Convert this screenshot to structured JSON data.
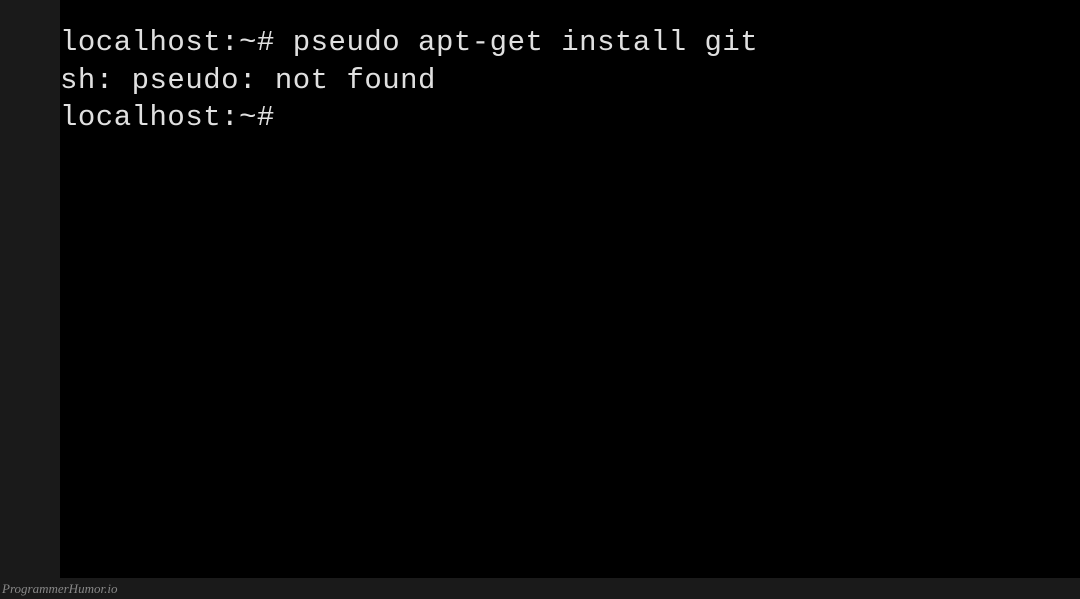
{
  "terminal": {
    "lines": [
      {
        "prompt": "localhost:~# ",
        "command": "pseudo apt-get install git"
      },
      {
        "output": "sh: pseudo: not found"
      },
      {
        "prompt": "localhost:~# ",
        "command": ""
      }
    ],
    "line1": "localhost:~# pseudo apt-get install git",
    "line2": "sh: pseudo: not found",
    "line3": "localhost:~#"
  },
  "watermark": "ProgrammerHumor.io",
  "colors": {
    "background_outer": "#1a1a1a",
    "background_terminal": "#000000",
    "text": "#e0e0e0",
    "watermark": "#888888"
  }
}
